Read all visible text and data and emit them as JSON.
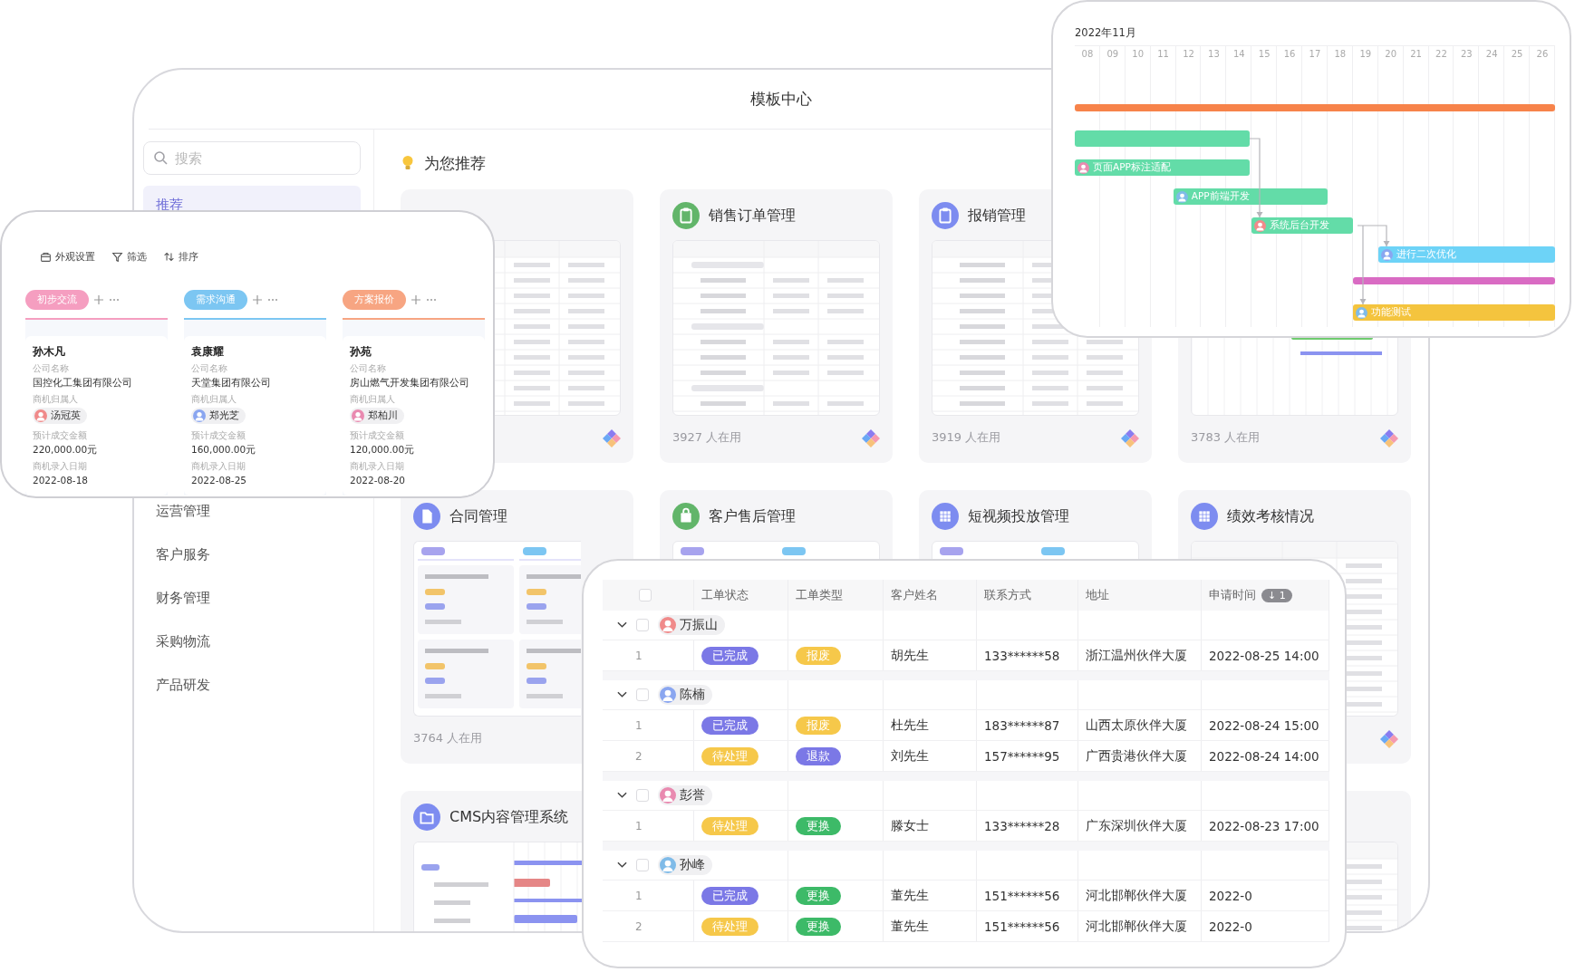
{
  "window": {
    "title": "模板中心"
  },
  "sidebar": {
    "search": {
      "placeholder": "搜索"
    },
    "items": [
      {
        "label": "推荐",
        "selected": true
      },
      {
        "label": "运营管理",
        "selected": false
      },
      {
        "label": "客户服务",
        "selected": false
      },
      {
        "label": "财务管理",
        "selected": false
      },
      {
        "label": "采购物流",
        "selected": false
      },
      {
        "label": "产品研发",
        "selected": false
      }
    ]
  },
  "section_title": "为您推荐",
  "cards": [
    {
      "kind": "table"
    },
    {
      "kind": "grouped-table",
      "color": "#62b56a",
      "title": "销售订单管理",
      "users": "3927 人在用"
    },
    {
      "kind": "table",
      "color": "#7d8cf0",
      "title": "报销管理",
      "users": "3919 人在用"
    },
    {
      "kind": "gantt",
      "users": "3783 人在用"
    },
    {
      "kind": "kanban",
      "color": "#7d8cf0",
      "title": "合同管理",
      "users": "3764 人在用"
    },
    {
      "kind": "kanban",
      "color": "#62b56a",
      "title": "客户售后管理"
    },
    {
      "kind": "kanban",
      "color": "#7d8cf0",
      "title": "短视频投放管理"
    },
    {
      "kind": "table",
      "color": "#7d8cf0",
      "title": "绩效考核情况"
    },
    {
      "kind": "gantt-table",
      "color": "#7d8cf0",
      "title": "CMS内容管理系统"
    },
    {
      "kind": "table"
    }
  ],
  "kanban": {
    "toolbar": [
      {
        "kind": "appearance",
        "label": "外观设置"
      },
      {
        "kind": "filter",
        "label": "筛选"
      },
      {
        "kind": "sort",
        "label": "排序"
      }
    ],
    "columns": [
      {
        "label": "初步交流",
        "color": "#f59ec0",
        "cards": [
          {
            "name": "孙木凡",
            "fields": [
              {
                "kind": "text",
                "label": "公司名称",
                "value": "国控化工集团有限公司"
              },
              {
                "kind": "person",
                "label": "商机归属人",
                "value": "汤冠英"
              },
              {
                "kind": "text",
                "label": "预计成交金额",
                "value": "220,000.00元"
              },
              {
                "kind": "text",
                "label": "商机录入日期",
                "value": "2022-08-18"
              }
            ]
          }
        ]
      },
      {
        "label": "需求沟通",
        "color": "#7cc6f2",
        "cards": [
          {
            "name": "袁康耀",
            "fields": [
              {
                "kind": "text",
                "label": "公司名称",
                "value": "天堂集团有限公司"
              },
              {
                "kind": "person",
                "label": "商机归属人",
                "value": "郑光芝"
              },
              {
                "kind": "text",
                "label": "预计成交金额",
                "value": "160,000.00元"
              },
              {
                "kind": "text",
                "label": "商机录入日期",
                "value": "2022-08-25"
              }
            ]
          }
        ]
      },
      {
        "label": "方案报价",
        "color": "#f7a582",
        "cards": [
          {
            "name": "孙苑",
            "fields": [
              {
                "kind": "text",
                "label": "公司名称",
                "value": "房山燃气开发集团有限公司"
              },
              {
                "kind": "person",
                "label": "商机归属人",
                "value": "郑柏川"
              },
              {
                "kind": "text",
                "label": "预计成交金额",
                "value": "120,000.00元"
              },
              {
                "kind": "text",
                "label": "商机录入日期",
                "value": "2022-08-20"
              }
            ]
          }
        ]
      }
    ]
  },
  "gantt": {
    "month": "2022年11月",
    "days": [
      "08",
      "09",
      "10",
      "11",
      "12",
      "13",
      "14",
      "15",
      "16",
      "17",
      "18",
      "19",
      "20",
      "21",
      "22",
      "23",
      "24",
      "25",
      "26"
    ],
    "bars": [
      {
        "color": "#f7834a"
      },
      {
        "color": "#63dca8"
      },
      {
        "label": "页面APP标注适配",
        "color": "#63dca8"
      },
      {
        "label": "APP前端开发",
        "color": "#63dca8"
      },
      {
        "label": "系统后台开发",
        "color": "#63dca8"
      },
      {
        "label": "进行二次优化",
        "color": "#6dd3f7"
      },
      {
        "color": "#d96bc3"
      },
      {
        "label": "功能测试",
        "color": "#f4c43e"
      }
    ]
  },
  "table": {
    "select_all_checked": false,
    "columns": [
      {
        "label": "工单状态"
      },
      {
        "label": "工单类型"
      },
      {
        "label": "客户姓名"
      },
      {
        "label": "联系方式"
      },
      {
        "label": "地址"
      },
      {
        "label": "申请时间",
        "badge": "↓ 1"
      }
    ],
    "groups": [
      {
        "owner": "万振山",
        "expanded": true,
        "checked": false,
        "rows": [
          {
            "index": "1",
            "status": {
              "label": "已完成",
              "color": "#7b78e6"
            },
            "type": {
              "label": "报废",
              "color": "#f6c84a"
            },
            "customer": "胡先生",
            "phone": "133******58",
            "address": "浙江温州伙伴大厦",
            "time": "2022-08-25 14:00"
          }
        ]
      },
      {
        "owner": "陈楠",
        "expanded": true,
        "checked": false,
        "rows": [
          {
            "index": "1",
            "status": {
              "label": "已完成",
              "color": "#7b78e6"
            },
            "type": {
              "label": "报废",
              "color": "#f6c84a"
            },
            "customer": "杜先生",
            "phone": "183******87",
            "address": "山西太原伙伴大厦",
            "time": "2022-08-24 15:00"
          },
          {
            "index": "2",
            "status": {
              "label": "待处理",
              "color": "#f6c84a"
            },
            "type": {
              "label": "退款",
              "color": "#7b78e6"
            },
            "customer": "刘先生",
            "phone": "157******95",
            "address": "广西贵港伙伴大厦",
            "time": "2022-08-24 14:00"
          }
        ]
      },
      {
        "owner": "彭誉",
        "expanded": true,
        "checked": false,
        "rows": [
          {
            "index": "1",
            "status": {
              "label": "待处理",
              "color": "#f6c84a"
            },
            "type": {
              "label": "更换",
              "color": "#3dba68"
            },
            "customer": "滕女士",
            "phone": "133******28",
            "address": "广东深圳伙伴大厦",
            "time": "2022-08-23 17:00"
          }
        ]
      },
      {
        "owner": "孙峰",
        "expanded": true,
        "checked": false,
        "rows": [
          {
            "index": "1",
            "status": {
              "label": "已完成",
              "color": "#7b78e6"
            },
            "type": {
              "label": "更换",
              "color": "#3dba68"
            },
            "customer": "董先生",
            "phone": "151******56",
            "address": "河北邯郸伙伴大厦",
            "time": "2022-0"
          },
          {
            "index": "2",
            "status": {
              "label": "待处理",
              "color": "#f6c84a"
            },
            "type": {
              "label": "更换",
              "color": "#3dba68"
            },
            "customer": "董先生",
            "phone": "151******56",
            "address": "河北邯郸伙伴大厦",
            "time": "2022-0"
          }
        ]
      }
    ]
  }
}
